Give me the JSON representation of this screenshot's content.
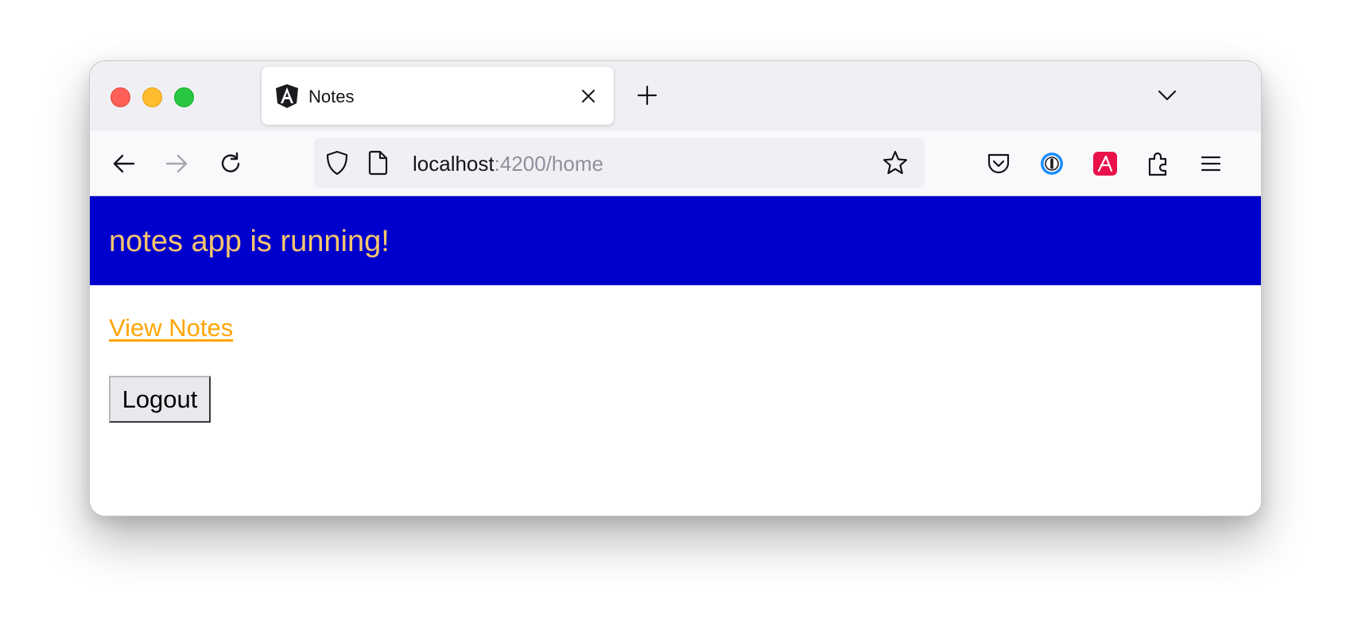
{
  "browser": {
    "tab": {
      "title": "Notes",
      "favicon": "angular-logo-icon"
    },
    "url": {
      "host": "localhost",
      "rest": ":4200/home"
    },
    "toolbar_icons": [
      "back-arrow-icon",
      "forward-arrow-icon",
      "reload-icon",
      "shield-icon",
      "page-icon",
      "star-icon",
      "pocket-icon",
      "password-manager-icon",
      "red-extension-icon",
      "puzzle-piece-icon",
      "hamburger-menu-icon"
    ]
  },
  "app": {
    "header_title": "notes app is running!",
    "view_notes_link": "View Notes",
    "logout_button": "Logout"
  },
  "colors": {
    "header_background": "#0000cd",
    "header_text": "#f6c56e",
    "link": "#ffa500"
  }
}
